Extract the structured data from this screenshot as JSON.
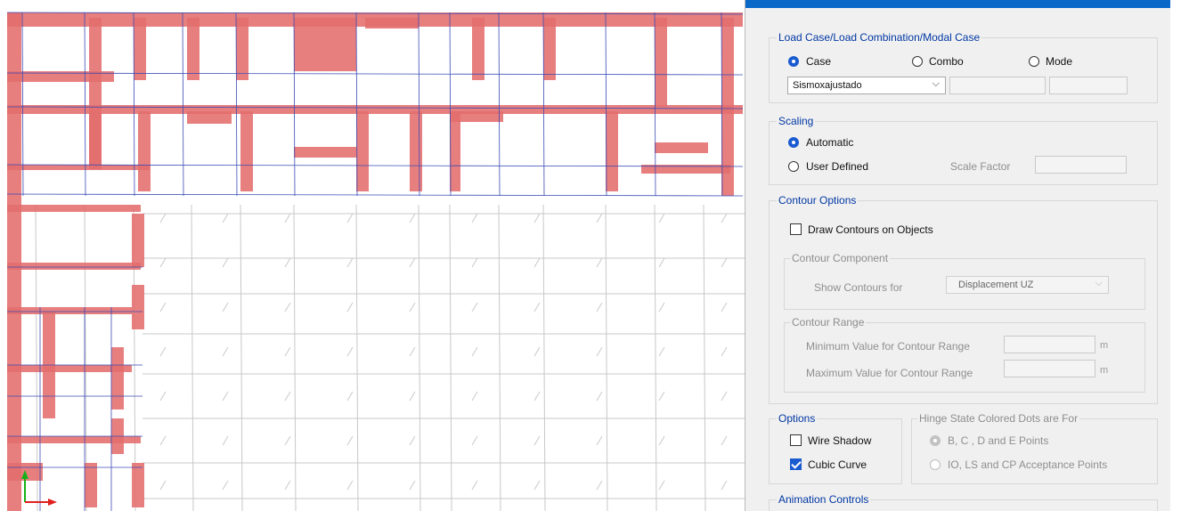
{
  "dialog": {
    "load_case": {
      "legend": "Load Case/Load Combination/Modal Case",
      "case_label": "Case",
      "combo_label": "Combo",
      "mode_label": "Mode",
      "selected": "case",
      "case_value": "Sismoxajustado",
      "chevron": "⌵"
    },
    "scaling": {
      "legend": "Scaling",
      "automatic_label": "Automatic",
      "user_defined_label": "User Defined",
      "scale_factor_label": "Scale Factor",
      "selected": "automatic"
    },
    "contour_options": {
      "legend": "Contour Options",
      "draw_contours_label": "Draw Contours on Objects",
      "draw_contours_checked": false,
      "component": {
        "legend": "Contour Component",
        "show_for_label": "Show Contours for",
        "show_for_value": "Displacement UZ"
      },
      "range": {
        "legend": "Contour Range",
        "min_label": "Minimum Value for Contour Range",
        "max_label": "Maximum Value for Contour Range",
        "min_unit": "m",
        "max_unit": "m"
      }
    },
    "options": {
      "legend": "Options",
      "wire_shadow_label": "Wire Shadow",
      "wire_shadow_checked": false,
      "cubic_curve_label": "Cubic Curve",
      "cubic_curve_checked": true
    },
    "hinge": {
      "legend": "Hinge State Colored Dots are For",
      "bcde_label": "B, C , D and E Points",
      "acceptance_label": "IO, LS and CP Acceptance Points",
      "selected": "bcde"
    },
    "animation": {
      "legend": "Animation Controls"
    }
  },
  "viewport": {
    "wall_color": "#e46d6d",
    "frame_color": "#3b4bb5",
    "grid_color": "#c8c8c8",
    "axis_x_color": "#e02020",
    "axis_y_color": "#18b018"
  }
}
